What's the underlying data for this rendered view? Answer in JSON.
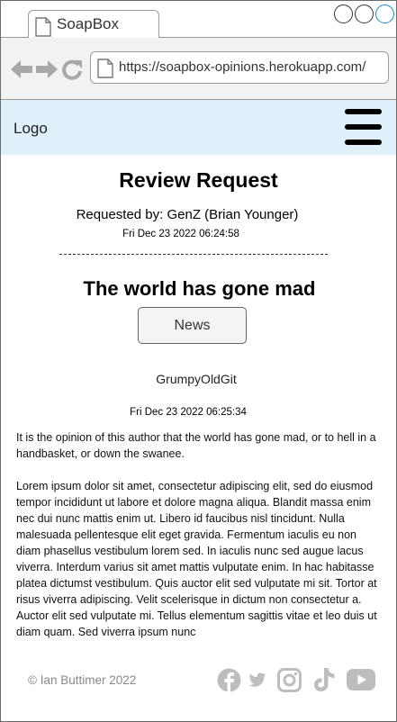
{
  "browser": {
    "tab_title": "SoapBox",
    "url": "https://soapbox-opinions.herokuapp.com/"
  },
  "site": {
    "logo": "Logo"
  },
  "review": {
    "heading": "Review Request",
    "requested_by": "Requested by: GenZ (Brian Younger)",
    "requested_date": "Fri Dec 23 2022 06:24:58"
  },
  "post": {
    "title": "The world has gone mad",
    "category": "News",
    "author": "GrumpyOldGit",
    "date": "Fri Dec 23 2022 06:25:34",
    "paragraphs": [
      "It is the opinion of this author that the world has gone mad, or to hell in a handbasket, or down the swanee.",
      "Lorem ipsum dolor sit amet, consectetur adipiscing elit, sed do eiusmod tempor incididunt ut labore et dolore magna aliqua. Blandit massa enim nec dui nunc mattis enim ut. Libero id faucibus nisl tincidunt. Nulla malesuada pellentesque elit eget gravida. Fermentum iaculis eu non diam phasellus vestibulum lorem sed. In iaculis nunc sed augue lacus viverra. Interdum varius sit amet mattis vulputate enim. In hac habitasse platea dictumst vestibulum. Quis auctor elit sed vulputate mi sit. Tortor at risus viverra adipiscing. Velit scelerisque in dictum non consectetur a. Auctor elit sed vulputate mi. Tellus elementum sagittis vitae et leo duis ut diam quam. Sed viverra ipsum nunc"
    ]
  },
  "footer": {
    "copyright": "© Ian Buttimer 2022",
    "socials": [
      "facebook-icon",
      "twitter-icon",
      "instagram-icon",
      "tiktok-icon",
      "youtube-icon"
    ]
  },
  "colors": {
    "header_bg": "#dff0fa",
    "accent": "#1e88c9",
    "icon_gray": "#bdbdbd"
  }
}
